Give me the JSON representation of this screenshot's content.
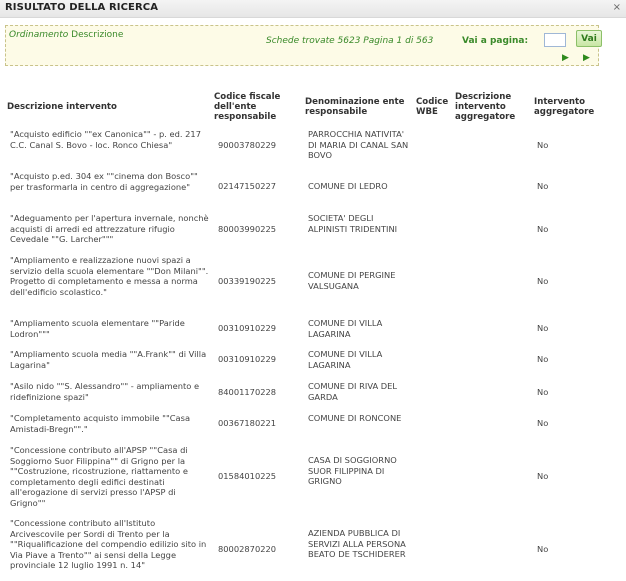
{
  "window": {
    "title": "RISULTATO DELLA RICERCA",
    "close_label": "×"
  },
  "search": {
    "ordinamento_label": "Ordinamento",
    "ordinamento_value": "Descrizione",
    "summary": "Schede trovate 5623 Pagina 1 di 563",
    "goto_label": "Vai a pagina:",
    "goto_value": "",
    "goto_button": "Vai",
    "next_label": "▶",
    "last_label": "▶"
  },
  "table": {
    "headers": [
      "Descrizione intervento",
      "Codice fiscale dell'ente responsabile",
      "Denominazione ente responsabile",
      "Codice WBE",
      "Descrizione intervento aggregatore",
      "Intervento aggregatore"
    ],
    "rows": [
      {
        "descrizione": "\"Acquisto edificio \"\"ex Canonica\"\" - p. ed. 217 C.C. Canal S. Bovo - loc. Ronco Chiesa\"",
        "codice_fiscale": "90003780229",
        "denominazione": "PARROCCHIA NATIVITA' DI MARIA DI CANAL SAN BOVO",
        "wbe": "",
        "desc_aggregatore": "",
        "aggregatore": "No"
      },
      {
        "descrizione": "\"Acquisto p.ed. 304 ex \"\"cinema don Bosco\"\" per trasformarla in centro di aggregazione\"",
        "codice_fiscale": "02147150227",
        "denominazione": "COMUNE DI LEDRO",
        "wbe": "",
        "desc_aggregatore": "",
        "aggregatore": "No"
      },
      {
        "descrizione": "\"Adeguamento per l'apertura invernale, nonchè acquisti di arredi ed attrezzature rifugio Cevedale \"\"G. Larcher\"\"\"",
        "codice_fiscale": "80003990225",
        "denominazione": "SOCIETA' DEGLI ALPINISTI TRIDENTINI",
        "wbe": "",
        "desc_aggregatore": "",
        "aggregatore": "No"
      },
      {
        "descrizione": "\"Ampliamento e realizzazione nuovi spazi a servizio della scuola elementare \"\"Don Milani\"\". Progetto di completamento e messa a norma dell'edificio scolastico.\"",
        "codice_fiscale": "00339190225",
        "denominazione": "COMUNE DI PERGINE VALSUGANA",
        "wbe": "",
        "desc_aggregatore": "",
        "aggregatore": "No"
      },
      {
        "descrizione": "\"Ampliamento scuola elementare \"\"Paride Lodron\"\"\"",
        "codice_fiscale": "00310910229",
        "denominazione": "COMUNE DI VILLA LAGARINA",
        "wbe": "",
        "desc_aggregatore": "",
        "aggregatore": "No"
      },
      {
        "descrizione": "\"Ampliamento scuola media \"\"A.Frank\"\" di Villa Lagarina\"",
        "codice_fiscale": "00310910229",
        "denominazione": "COMUNE DI VILLA LAGARINA",
        "wbe": "",
        "desc_aggregatore": "",
        "aggregatore": "No"
      },
      {
        "descrizione": "\"Asilo nido \"\"S. Alessandro\"\" - ampliamento e ridefinizione spazi\"",
        "codice_fiscale": "84001170228",
        "denominazione": "COMUNE DI RIVA DEL GARDA",
        "wbe": "",
        "desc_aggregatore": "",
        "aggregatore": "No"
      },
      {
        "descrizione": "\"Completamento acquisto immobile \"\"Casa Amistadi-Bregn\"\".\"",
        "codice_fiscale": "00367180221",
        "denominazione": "COMUNE DI RONCONE",
        "wbe": "",
        "desc_aggregatore": "",
        "aggregatore": "No"
      },
      {
        "descrizione": "\"Concessione contributo all'APSP \"\"Casa di Soggiorno Suor Filippina\"\" di Grigno per la \"\"Costruzione, ricostruzione, riattamento e completamento degli edifici destinati all'erogazione di servizi presso l'APSP di Grigno\"\"",
        "codice_fiscale": "01584010225",
        "denominazione": "CASA DI SOGGIORNO SUOR FILIPPINA DI GRIGNO",
        "wbe": "",
        "desc_aggregatore": "",
        "aggregatore": "No"
      },
      {
        "descrizione": "\"Concessione contributo all'Istituto Arcivescovile per Sordi di Trento per la \"\"Riqualificazione del compendio edilizio sito in Via Piave a Trento\"\" ai sensi della Legge provinciale 12 luglio 1991 n. 14\"",
        "codice_fiscale": "80002870220",
        "denominazione": "AZIENDA PUBBLICA DI SERVIZI ALLA PERSONA BEATO DE TSCHIDERER",
        "wbe": "",
        "desc_aggregatore": "",
        "aggregatore": "No"
      }
    ]
  }
}
